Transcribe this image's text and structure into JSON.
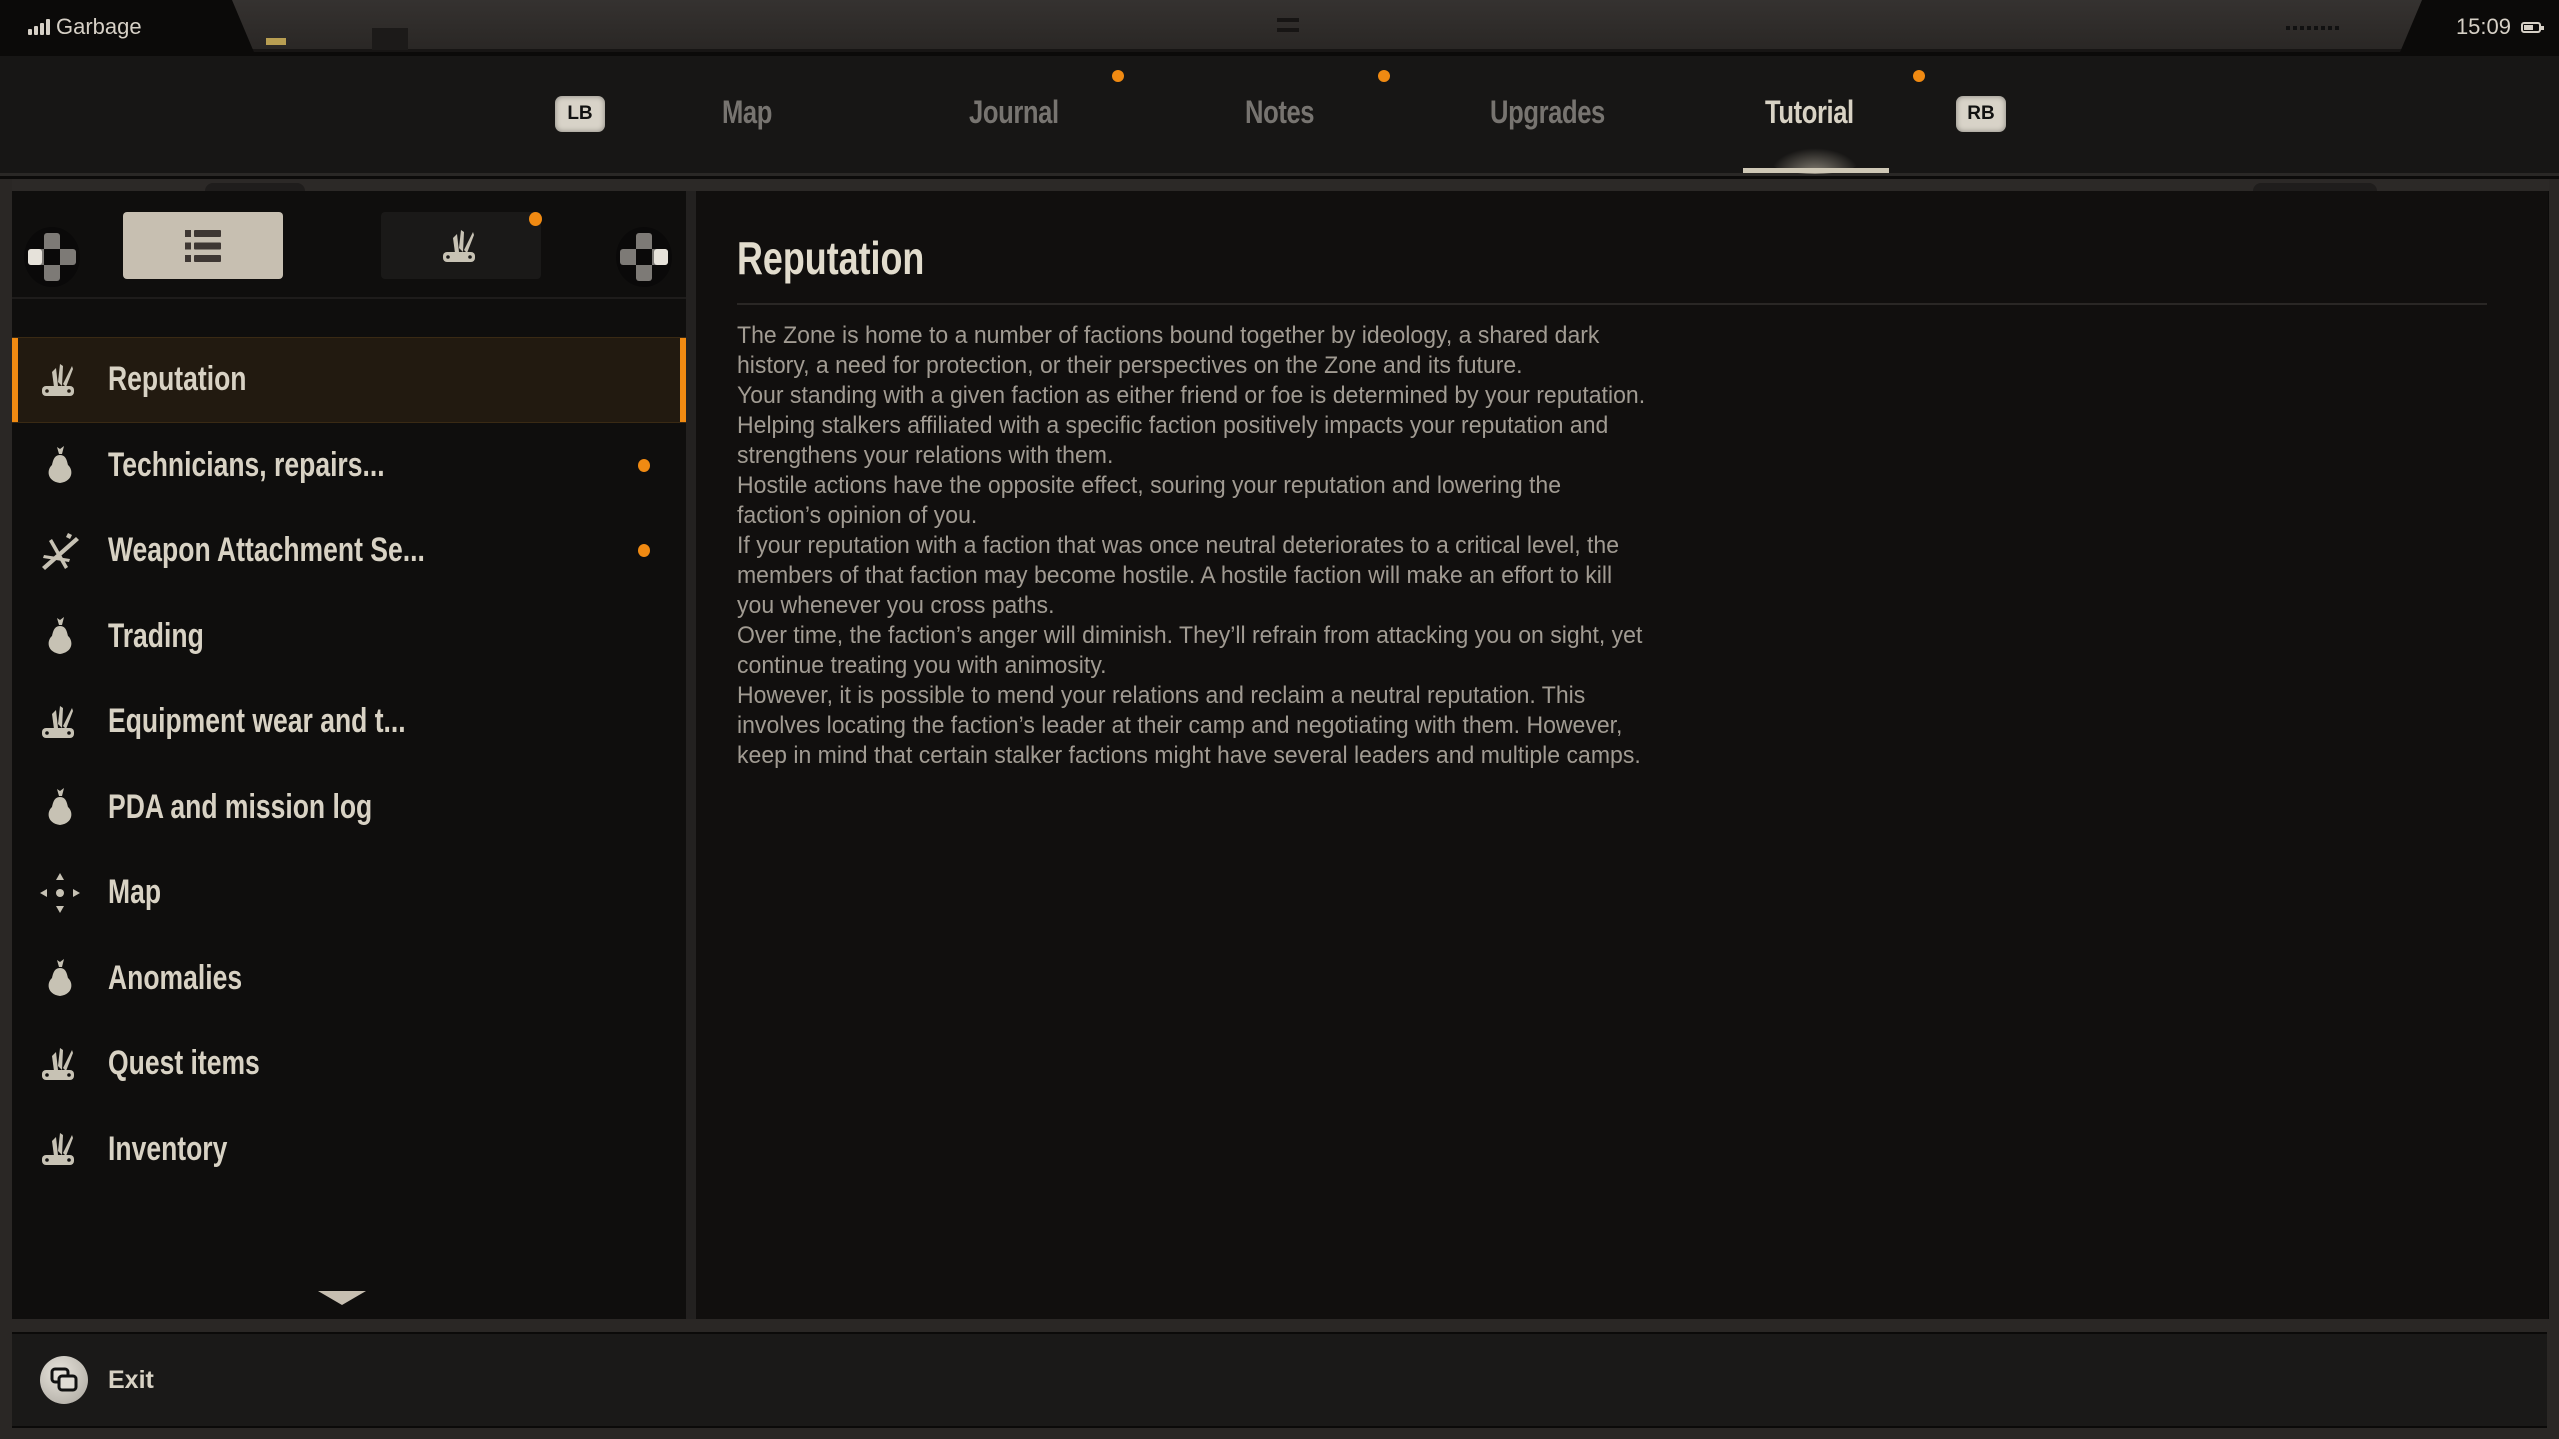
{
  "status_bar": {
    "carrier": "Garbage",
    "time": "15:09",
    "signal_icon": "signal-bars-icon",
    "battery_icon": "battery-icon"
  },
  "tabs": {
    "left_bumper": "LB",
    "right_bumper": "RB",
    "items": [
      {
        "label": "Map",
        "active": false,
        "notification": false
      },
      {
        "label": "Journal",
        "active": false,
        "notification": true
      },
      {
        "label": "Notes",
        "active": false,
        "notification": true
      },
      {
        "label": "Upgrades",
        "active": false,
        "notification": false
      },
      {
        "label": "Tutorial",
        "active": true,
        "notification": true
      }
    ]
  },
  "sidebar": {
    "view_modes": [
      {
        "icon": "list-icon",
        "active": true,
        "notification": false
      },
      {
        "icon": "multitool-icon",
        "active": false,
        "notification": true
      }
    ],
    "items": [
      {
        "label": "Reputation",
        "icon": "multitool-icon",
        "selected": true,
        "notification": false
      },
      {
        "label": "Technicians, repairs...",
        "icon": "pear-icon",
        "selected": false,
        "notification": true
      },
      {
        "label": "Weapon Attachment Se...",
        "icon": "weapon-attachment-icon",
        "selected": false,
        "notification": true
      },
      {
        "label": "Trading",
        "icon": "pear-icon",
        "selected": false,
        "notification": false
      },
      {
        "label": "Equipment wear and t...",
        "icon": "multitool-icon",
        "selected": false,
        "notification": false
      },
      {
        "label": "PDA and mission log",
        "icon": "pear-icon",
        "selected": false,
        "notification": false
      },
      {
        "label": "Map",
        "icon": "compass-arrows-icon",
        "selected": false,
        "notification": false
      },
      {
        "label": "Anomalies",
        "icon": "pear-icon",
        "selected": false,
        "notification": false
      },
      {
        "label": "Quest items",
        "icon": "multitool-icon",
        "selected": false,
        "notification": false
      },
      {
        "label": "Inventory",
        "icon": "multitool-icon",
        "selected": false,
        "notification": false
      }
    ]
  },
  "content": {
    "title": "Reputation",
    "body": " The Zone is home to a number of factions bound together by ideology, a shared dark\nhistory, a need for protection, or their perspectives on the Zone and its future.\nYour standing with a given faction as either friend or foe is determined by your reputation.\nHelping stalkers affiliated with a specific faction positively impacts your reputation and\nstrengthens your relations with them.\nHostile actions have the opposite effect, souring your reputation and lowering the\nfaction’s opinion of you.\nIf your reputation with a faction that was once neutral deteriorates to a critical level, the\nmembers of that faction may become hostile. A hostile faction will make an effort to kill\nyou whenever you cross paths.\nOver time, the faction’s anger will diminish. They’ll refrain from attacking you on sight, yet\ncontinue treating you with animosity.\nHowever, it is possible to mend your relations and reclaim a neutral reputation. This\ninvolves locating the faction’s leader at their camp and negotiating with them. However,\nkeep in mind that certain stalker factions might have several leaders and multiple camps."
  },
  "footer": {
    "exit_label": "Exit"
  },
  "colors": {
    "accent": "#f08a12",
    "text_primary": "#d8d2c4",
    "text_muted": "#777470",
    "body_text": "#a19b92",
    "selected_bg": "#221a10"
  }
}
